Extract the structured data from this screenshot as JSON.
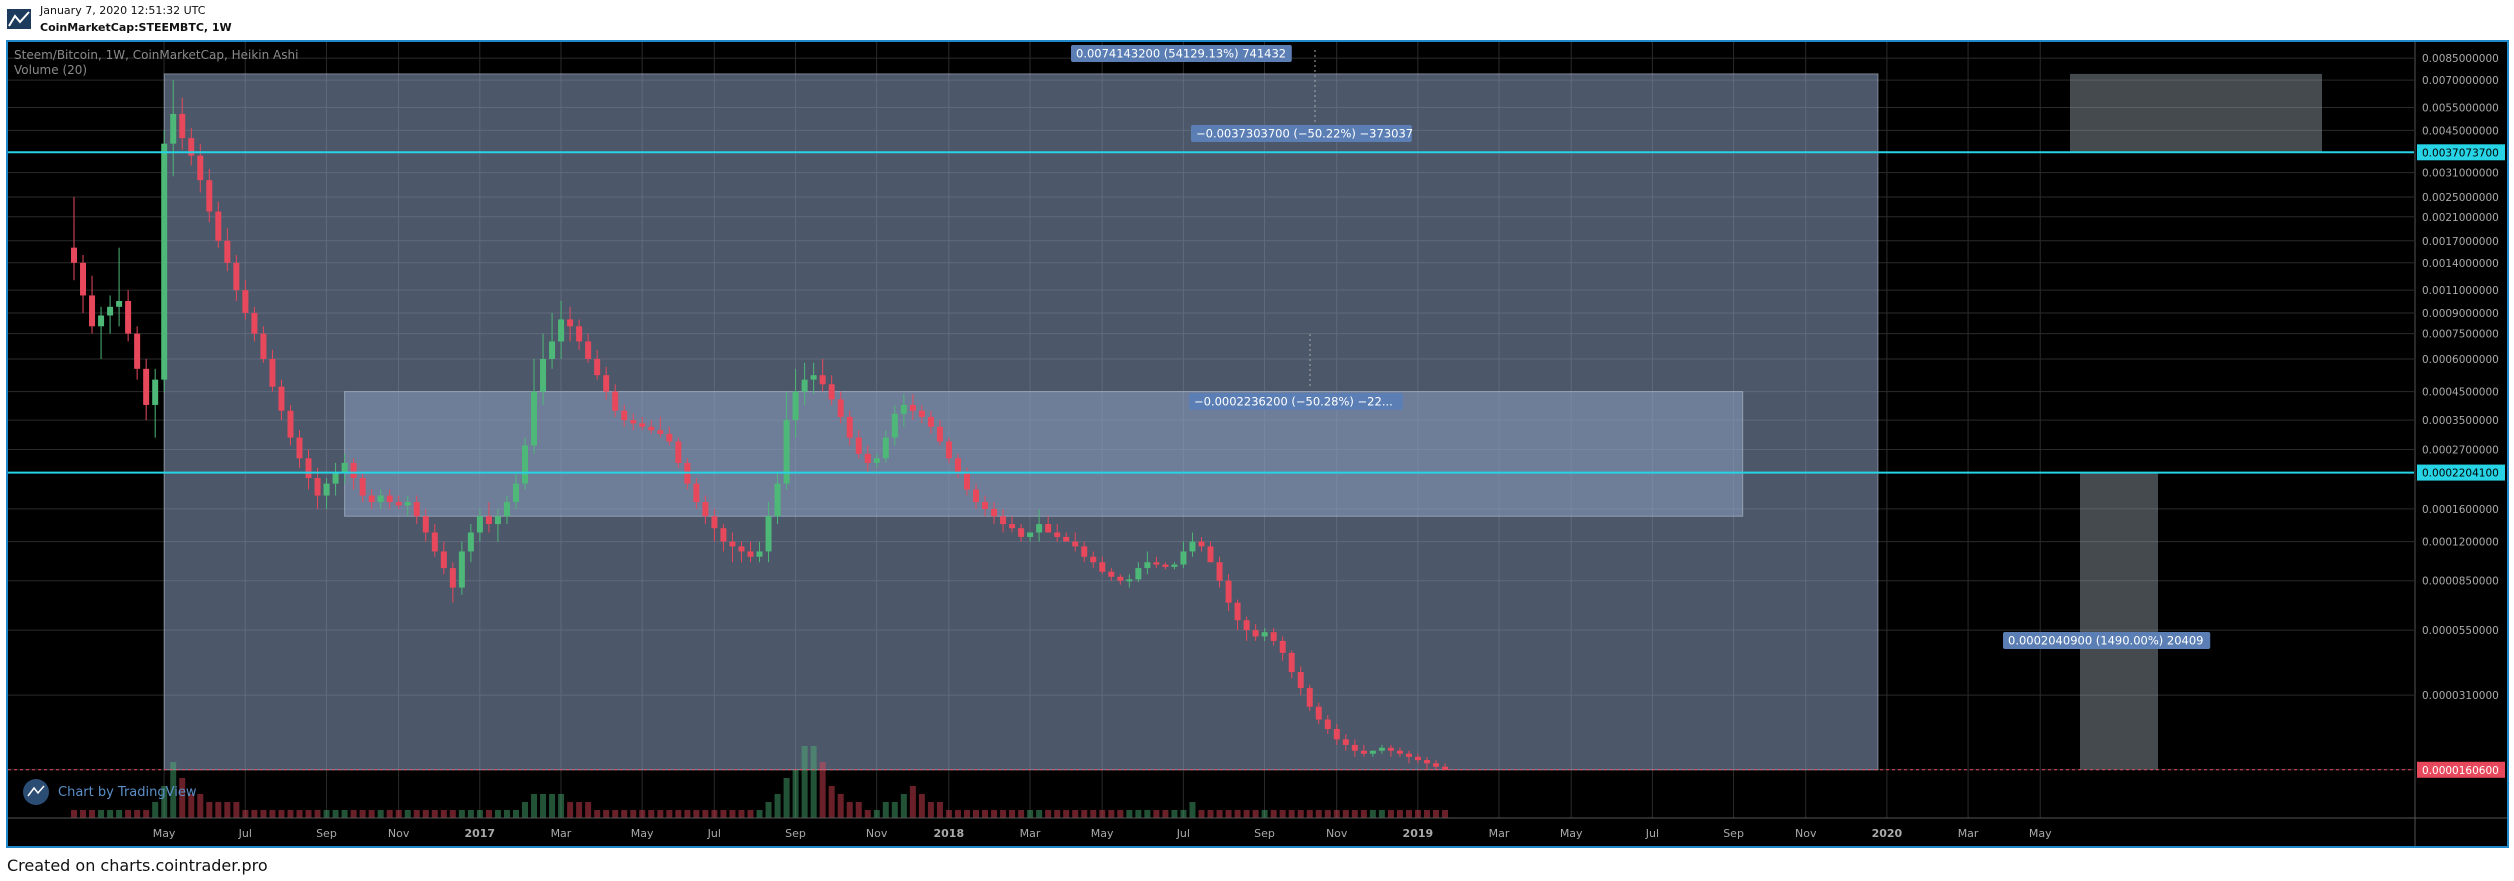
{
  "header": {
    "datetime": "January 7, 2020 12:51:32 UTC",
    "symbol": "CoinMarketCap:STEEMBTC, 1W"
  },
  "legend": {
    "title": "Steem/Bitcoin, 1W, CoinMarketCap, Heikin Ashi",
    "volume": "Volume (20)"
  },
  "watermark": "Chart by TradingView",
  "footer": "Created on charts.cointrader.pro",
  "colors": {
    "background": "#000000",
    "up": "#4eb878",
    "down": "#e8485c",
    "range_box": "#8a9fc0",
    "hline": "#26d4e6",
    "label_bg": "#5b7fb5"
  },
  "chart_data": {
    "type": "candlestick",
    "xlabel": "",
    "ylabel": "",
    "y_scale": "log",
    "y_ticks": [
      "0.0085000000",
      "0.0070000000",
      "0.0055000000",
      "0.0045000000",
      "0.0037073700",
      "0.0031000000",
      "0.0025000000",
      "0.0021000000",
      "0.0017000000",
      "0.0014000000",
      "0.0011000000",
      "0.0009000000",
      "0.0007500000",
      "0.0006000000",
      "0.0004500000",
      "0.0003500000",
      "0.0002700000",
      "0.0002204100",
      "0.0001600000",
      "0.0001200000",
      "0.0000850000",
      "0.0000550000",
      "0.0000310000",
      "0.0000160600"
    ],
    "y_tick_values": [
      0.0085,
      0.007,
      0.0055,
      0.0045,
      0.00370737,
      0.0031,
      0.0025,
      0.0021,
      0.0017,
      0.0014,
      0.0011,
      0.0009,
      0.00075,
      0.0006,
      0.00045,
      0.00035,
      0.00027,
      0.00022041,
      0.00016,
      0.00012,
      8.5e-05,
      5.5e-05,
      3.1e-05,
      1.606e-05
    ],
    "highlighted_prices": [
      {
        "label": "0.0037073700",
        "value": 0.00370737,
        "color": "#26d4e6"
      },
      {
        "label": "0.0002204100",
        "value": 0.00022041,
        "color": "#26d4e6"
      },
      {
        "label": "0.0000160600",
        "value": 1.606e-05,
        "color": "#e8485c"
      }
    ],
    "x_ticks": [
      "May",
      "Jul",
      "Sep",
      "Nov",
      "2017",
      "Mar",
      "May",
      "Jul",
      "Sep",
      "Nov",
      "2018",
      "Mar",
      "May",
      "Jul",
      "Sep",
      "Nov",
      "2019",
      "Mar",
      "May",
      "Jul",
      "Sep",
      "Nov",
      "2020",
      "Mar",
      "May"
    ],
    "x_tick_weeks": [
      4,
      13,
      22,
      30,
      39,
      48,
      57,
      65,
      74,
      83,
      91,
      100,
      108,
      117,
      126,
      134,
      143,
      152,
      160,
      169,
      178,
      186,
      195,
      204,
      212
    ],
    "measure_annotations": [
      "0.0074143200 (54129.13%) 741432",
      "−0.0037303700 (−50.22%) −373037",
      "0.0002040900 (1490.00%) 20409",
      "−0.0002236200 (−50.28%) −22..."
    ],
    "measure_boxes": [
      {
        "from_week": 10,
        "to_week": 200,
        "low": 1.606e-05,
        "high": 0.0074
      },
      {
        "from_week": 30,
        "to_week": 185,
        "low": 0.00015,
        "high": 0.00045
      }
    ],
    "candles": [
      [
        0.0016,
        0.0025,
        0.0012,
        0.0014,
        1
      ],
      [
        0.0014,
        0.0015,
        0.0009,
        0.00105,
        1
      ],
      [
        0.00105,
        0.00125,
        0.00075,
        0.0008,
        1
      ],
      [
        0.0008,
        0.00095,
        0.0006,
        0.00088,
        1
      ],
      [
        0.00088,
        0.00105,
        0.00075,
        0.00095,
        1
      ],
      [
        0.00095,
        0.0016,
        0.0008,
        0.001,
        1
      ],
      [
        0.001,
        0.0011,
        0.0007,
        0.00075,
        1
      ],
      [
        0.00075,
        0.0008,
        0.0005,
        0.00055,
        1
      ],
      [
        0.00055,
        0.0006,
        0.00035,
        0.0004,
        1
      ],
      [
        0.0004,
        0.00055,
        0.0003,
        0.0005,
        2
      ],
      [
        0.0005,
        0.0045,
        0.00045,
        0.004,
        4
      ],
      [
        0.004,
        0.007,
        0.003,
        0.0052,
        7
      ],
      [
        0.0052,
        0.006,
        0.0038,
        0.0042,
        5
      ],
      [
        0.0042,
        0.0046,
        0.0033,
        0.0036,
        3
      ],
      [
        0.0036,
        0.004,
        0.0026,
        0.0029,
        3
      ],
      [
        0.0029,
        0.0032,
        0.002,
        0.0022,
        2
      ],
      [
        0.0022,
        0.0024,
        0.0016,
        0.0017,
        2
      ],
      [
        0.0017,
        0.0019,
        0.0013,
        0.0014,
        2
      ],
      [
        0.0014,
        0.0015,
        0.001,
        0.0011,
        2
      ],
      [
        0.0011,
        0.0012,
        0.00085,
        0.0009,
        1
      ],
      [
        0.0009,
        0.00095,
        0.0007,
        0.00075,
        1
      ],
      [
        0.00075,
        0.0008,
        0.00058,
        0.0006,
        1
      ],
      [
        0.0006,
        0.00065,
        0.00045,
        0.00047,
        1
      ],
      [
        0.00047,
        0.0005,
        0.00035,
        0.00038,
        1
      ],
      [
        0.00038,
        0.0004,
        0.00028,
        0.0003,
        1
      ],
      [
        0.0003,
        0.00032,
        0.00023,
        0.00025,
        1
      ],
      [
        0.00025,
        0.00027,
        0.00019,
        0.00021,
        1
      ],
      [
        0.00021,
        0.00023,
        0.00016,
        0.00018,
        1
      ],
      [
        0.00018,
        0.00021,
        0.00016,
        0.0002,
        1
      ],
      [
        0.0002,
        0.00024,
        0.00018,
        0.00022,
        1
      ],
      [
        0.00022,
        0.00026,
        0.0002,
        0.00024,
        1
      ],
      [
        0.00024,
        0.00025,
        0.00019,
        0.00021,
        1
      ],
      [
        0.00021,
        0.00022,
        0.00017,
        0.00018,
        1
      ],
      [
        0.00018,
        0.00019,
        0.00016,
        0.00017,
        1
      ],
      [
        0.00017,
        0.00019,
        0.00016,
        0.00018,
        1
      ],
      [
        0.00018,
        0.00019,
        0.00016,
        0.00017,
        1
      ],
      [
        0.00017,
        0.00018,
        0.00016,
        0.000165,
        1
      ],
      [
        0.000165,
        0.00018,
        0.00015,
        0.00017,
        1
      ],
      [
        0.00017,
        0.00018,
        0.00014,
        0.00015,
        1
      ],
      [
        0.00015,
        0.00016,
        0.00012,
        0.00013,
        1
      ],
      [
        0.00013,
        0.00014,
        0.000105,
        0.00011,
        1
      ],
      [
        0.00011,
        0.00012,
        9e-05,
        9.5e-05,
        1
      ],
      [
        9.5e-05,
        0.0001,
        7e-05,
        8e-05,
        1
      ],
      [
        8e-05,
        0.00012,
        7.5e-05,
        0.00011,
        1
      ],
      [
        0.00011,
        0.00014,
        0.0001,
        0.00013,
        1
      ],
      [
        0.00013,
        0.00016,
        0.00012,
        0.00015,
        1
      ],
      [
        0.00015,
        0.00017,
        0.00013,
        0.00014,
        1
      ],
      [
        0.00014,
        0.00016,
        0.00012,
        0.00015,
        1
      ],
      [
        0.00015,
        0.00018,
        0.00014,
        0.00017,
        1
      ],
      [
        0.00017,
        0.00022,
        0.00016,
        0.0002,
        1
      ],
      [
        0.0002,
        0.0003,
        0.00019,
        0.00028,
        2
      ],
      [
        0.00028,
        0.0006,
        0.00026,
        0.00045,
        3
      ],
      [
        0.00045,
        0.00075,
        0.0004,
        0.0006,
        3
      ],
      [
        0.0006,
        0.0009,
        0.00055,
        0.0007,
        3
      ],
      [
        0.0007,
        0.001,
        0.0006,
        0.00085,
        3
      ],
      [
        0.00085,
        0.00095,
        0.0007,
        0.0008,
        2
      ],
      [
        0.0008,
        0.00085,
        0.00065,
        0.0007,
        2
      ],
      [
        0.0007,
        0.00075,
        0.00058,
        0.0006,
        2
      ],
      [
        0.0006,
        0.00065,
        0.0005,
        0.00052,
        1
      ],
      [
        0.00052,
        0.00056,
        0.00042,
        0.00045,
        1
      ],
      [
        0.00045,
        0.00048,
        0.00036,
        0.00038,
        1
      ],
      [
        0.00038,
        0.0004,
        0.00033,
        0.00035,
        1
      ],
      [
        0.00035,
        0.00037,
        0.00032,
        0.00034,
        1
      ],
      [
        0.00034,
        0.00036,
        0.00032,
        0.00033,
        1
      ],
      [
        0.00033,
        0.00035,
        0.00031,
        0.00032,
        1
      ],
      [
        0.00032,
        0.00036,
        0.0003,
        0.00031,
        1
      ],
      [
        0.00031,
        0.00033,
        0.00028,
        0.00029,
        1
      ],
      [
        0.00029,
        0.0003,
        0.00023,
        0.00024,
        1
      ],
      [
        0.00024,
        0.00025,
        0.00019,
        0.0002,
        1
      ],
      [
        0.0002,
        0.00021,
        0.00016,
        0.00017,
        1
      ],
      [
        0.00017,
        0.00018,
        0.00014,
        0.00015,
        1
      ],
      [
        0.00015,
        0.00016,
        0.00012,
        0.000135,
        1
      ],
      [
        0.000135,
        0.00014,
        0.00011,
        0.00012,
        1
      ],
      [
        0.00012,
        0.00013,
        0.0001,
        0.000115,
        1
      ],
      [
        0.000115,
        0.00012,
        0.0001,
        0.00011,
        1
      ],
      [
        0.00011,
        0.00012,
        0.0001,
        0.000105,
        1
      ],
      [
        0.000105,
        0.00012,
        0.0001,
        0.00011,
        1
      ],
      [
        0.00011,
        0.00017,
        0.0001,
        0.00015,
        2
      ],
      [
        0.00015,
        0.00022,
        0.00014,
        0.0002,
        3
      ],
      [
        0.0002,
        0.00045,
        0.00019,
        0.00035,
        5
      ],
      [
        0.00035,
        0.00055,
        0.0003,
        0.00045,
        6
      ],
      [
        0.00045,
        0.00058,
        0.0004,
        0.0005,
        9
      ],
      [
        0.0005,
        0.00058,
        0.00044,
        0.00052,
        9
      ],
      [
        0.00052,
        0.0006,
        0.00045,
        0.00048,
        7
      ],
      [
        0.00048,
        0.00052,
        0.0004,
        0.00042,
        4
      ],
      [
        0.00042,
        0.00045,
        0.00034,
        0.00036,
        3
      ],
      [
        0.00036,
        0.00038,
        0.00028,
        0.0003,
        2
      ],
      [
        0.0003,
        0.00032,
        0.00025,
        0.00026,
        2
      ],
      [
        0.00026,
        0.00028,
        0.00022,
        0.00024,
        1
      ],
      [
        0.00024,
        0.00026,
        0.00023,
        0.00025,
        1
      ],
      [
        0.00025,
        0.00032,
        0.00024,
        0.0003,
        2
      ],
      [
        0.0003,
        0.0004,
        0.00028,
        0.00037,
        2
      ],
      [
        0.00037,
        0.00044,
        0.00033,
        0.0004,
        3
      ],
      [
        0.0004,
        0.00044,
        0.00035,
        0.00038,
        4
      ],
      [
        0.00038,
        0.0004,
        0.00034,
        0.00036,
        3
      ],
      [
        0.00036,
        0.00038,
        0.00031,
        0.00033,
        2
      ],
      [
        0.00033,
        0.00035,
        0.00028,
        0.00029,
        2
      ],
      [
        0.00029,
        0.0003,
        0.00024,
        0.00025,
        1
      ],
      [
        0.00025,
        0.00026,
        0.00021,
        0.00022,
        1
      ],
      [
        0.00022,
        0.00023,
        0.00018,
        0.00019,
        1
      ],
      [
        0.00019,
        0.0002,
        0.00016,
        0.00017,
        1
      ],
      [
        0.00017,
        0.00018,
        0.00015,
        0.00016,
        1
      ],
      [
        0.00016,
        0.00017,
        0.00014,
        0.00015,
        1
      ],
      [
        0.00015,
        0.00016,
        0.00013,
        0.00014,
        1
      ],
      [
        0.00014,
        0.00015,
        0.00013,
        0.000135,
        1
      ],
      [
        0.000135,
        0.00014,
        0.00012,
        0.000125,
        1
      ],
      [
        0.000125,
        0.00013,
        0.00012,
        0.00013,
        1
      ],
      [
        0.00013,
        0.00016,
        0.00012,
        0.00014,
        1
      ],
      [
        0.00014,
        0.00015,
        0.00013,
        0.00013,
        1
      ],
      [
        0.00013,
        0.00014,
        0.00012,
        0.000125,
        1
      ],
      [
        0.000125,
        0.00013,
        0.00012,
        0.00012,
        1
      ],
      [
        0.00012,
        0.00013,
        0.00011,
        0.000115,
        1
      ],
      [
        0.000115,
        0.00012,
        0.0001,
        0.000105,
        1
      ],
      [
        0.000105,
        0.00011,
        9.5e-05,
        0.0001,
        1
      ],
      [
        0.0001,
        0.000105,
        9e-05,
        9.2e-05,
        1
      ],
      [
        9.2e-05,
        9.5e-05,
        8.5e-05,
        8.8e-05,
        1
      ],
      [
        8.8e-05,
        9e-05,
        8.2e-05,
        8.5e-05,
        1
      ],
      [
        8.5e-05,
        9e-05,
        8e-05,
        8.6e-05,
        1
      ],
      [
        8.6e-05,
        0.0001,
        8.4e-05,
        9.5e-05,
        1
      ],
      [
        9.5e-05,
        0.00011,
        9e-05,
        0.0001,
        1
      ],
      [
        0.0001,
        0.000105,
        9.5e-05,
        9.8e-05,
        1
      ],
      [
        9.8e-05,
        0.0001,
        9.4e-05,
        9.6e-05,
        1
      ],
      [
        9.6e-05,
        0.0001,
        9.4e-05,
        9.8e-05,
        1
      ],
      [
        9.8e-05,
        0.00012,
        9.5e-05,
        0.00011,
        1
      ],
      [
        0.00011,
        0.00013,
        0.000105,
        0.00012,
        2
      ],
      [
        0.00012,
        0.000125,
        0.00011,
        0.000115,
        1
      ],
      [
        0.000115,
        0.00012,
        0.0001,
        0.0001,
        1
      ],
      [
        0.0001,
        0.000105,
        8e-05,
        8.5e-05,
        1
      ],
      [
        8.5e-05,
        9e-05,
        6.5e-05,
        7e-05,
        1
      ],
      [
        7e-05,
        7.2e-05,
        5.5e-05,
        6e-05,
        1
      ],
      [
        6e-05,
        6.2e-05,
        5e-05,
        5.5e-05,
        1
      ],
      [
        5.5e-05,
        5.8e-05,
        5e-05,
        5.2e-05,
        1
      ],
      [
        5.2e-05,
        5.6e-05,
        5e-05,
        5.4e-05,
        1
      ],
      [
        5.4e-05,
        5.6e-05,
        4.8e-05,
        5e-05,
        1
      ],
      [
        5e-05,
        5.2e-05,
        4.2e-05,
        4.5e-05,
        1
      ],
      [
        4.5e-05,
        4.6e-05,
        3.6e-05,
        3.8e-05,
        1
      ],
      [
        3.8e-05,
        4e-05,
        3.1e-05,
        3.3e-05,
        1
      ],
      [
        3.3e-05,
        3.4e-05,
        2.7e-05,
        2.8e-05,
        1
      ],
      [
        2.8e-05,
        2.9e-05,
        2.4e-05,
        2.5e-05,
        1
      ],
      [
        2.5e-05,
        2.6e-05,
        2.2e-05,
        2.3e-05,
        1
      ],
      [
        2.3e-05,
        2.4e-05,
        2e-05,
        2.1e-05,
        1
      ],
      [
        2.1e-05,
        2.2e-05,
        1.9e-05,
        2e-05,
        1
      ],
      [
        2e-05,
        2.1e-05,
        1.8e-05,
        1.9e-05,
        1
      ],
      [
        1.9e-05,
        2e-05,
        1.8e-05,
        1.85e-05,
        1
      ],
      [
        1.85e-05,
        1.9e-05,
        1.8e-05,
        1.9e-05,
        1
      ],
      [
        1.9e-05,
        2e-05,
        1.85e-05,
        1.95e-05,
        1
      ],
      [
        1.95e-05,
        2e-05,
        1.8e-05,
        1.9e-05,
        1
      ],
      [
        1.9e-05,
        1.95e-05,
        1.8e-05,
        1.85e-05,
        1
      ],
      [
        1.85e-05,
        1.9e-05,
        1.7e-05,
        1.8e-05,
        1
      ],
      [
        1.8e-05,
        1.85e-05,
        1.7e-05,
        1.75e-05,
        1
      ],
      [
        1.75e-05,
        1.8e-05,
        1.6e-05,
        1.7e-05,
        1
      ],
      [
        1.7e-05,
        1.75e-05,
        1.6e-05,
        1.65e-05,
        1
      ],
      [
        1.65e-05,
        1.7e-05,
        1.6e-05,
        1.606e-05,
        1
      ]
    ]
  }
}
